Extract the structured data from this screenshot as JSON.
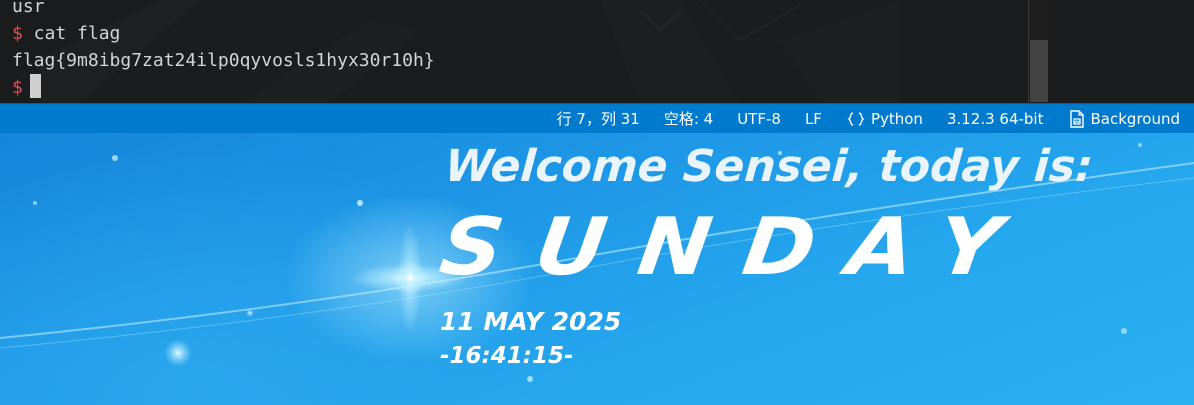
{
  "terminal": {
    "lines": [
      {
        "prompt": "",
        "text": "usr"
      },
      {
        "prompt": "$",
        "text": " cat flag"
      },
      {
        "prompt": "",
        "text": "flag{9m8ibg7zat24ilp0qyvosls1hyx30r10h}"
      },
      {
        "prompt": "$",
        "text": ""
      }
    ],
    "prompt_color": "#e05252"
  },
  "statusbar": {
    "position": "行 7，列 31",
    "indent": "空格: 4",
    "encoding": "UTF-8",
    "eol": "LF",
    "language": "Python",
    "language_icon": "braces-icon",
    "interpreter": "3.12.3 64-bit",
    "background": "Background",
    "background_icon": "file-image-icon",
    "color": "#007acc"
  },
  "desktop": {
    "welcome": "Welcome Sensei, today is:",
    "day": "SUNDAY",
    "date": "11 MAY 2025",
    "time": "-16:41:15-"
  }
}
